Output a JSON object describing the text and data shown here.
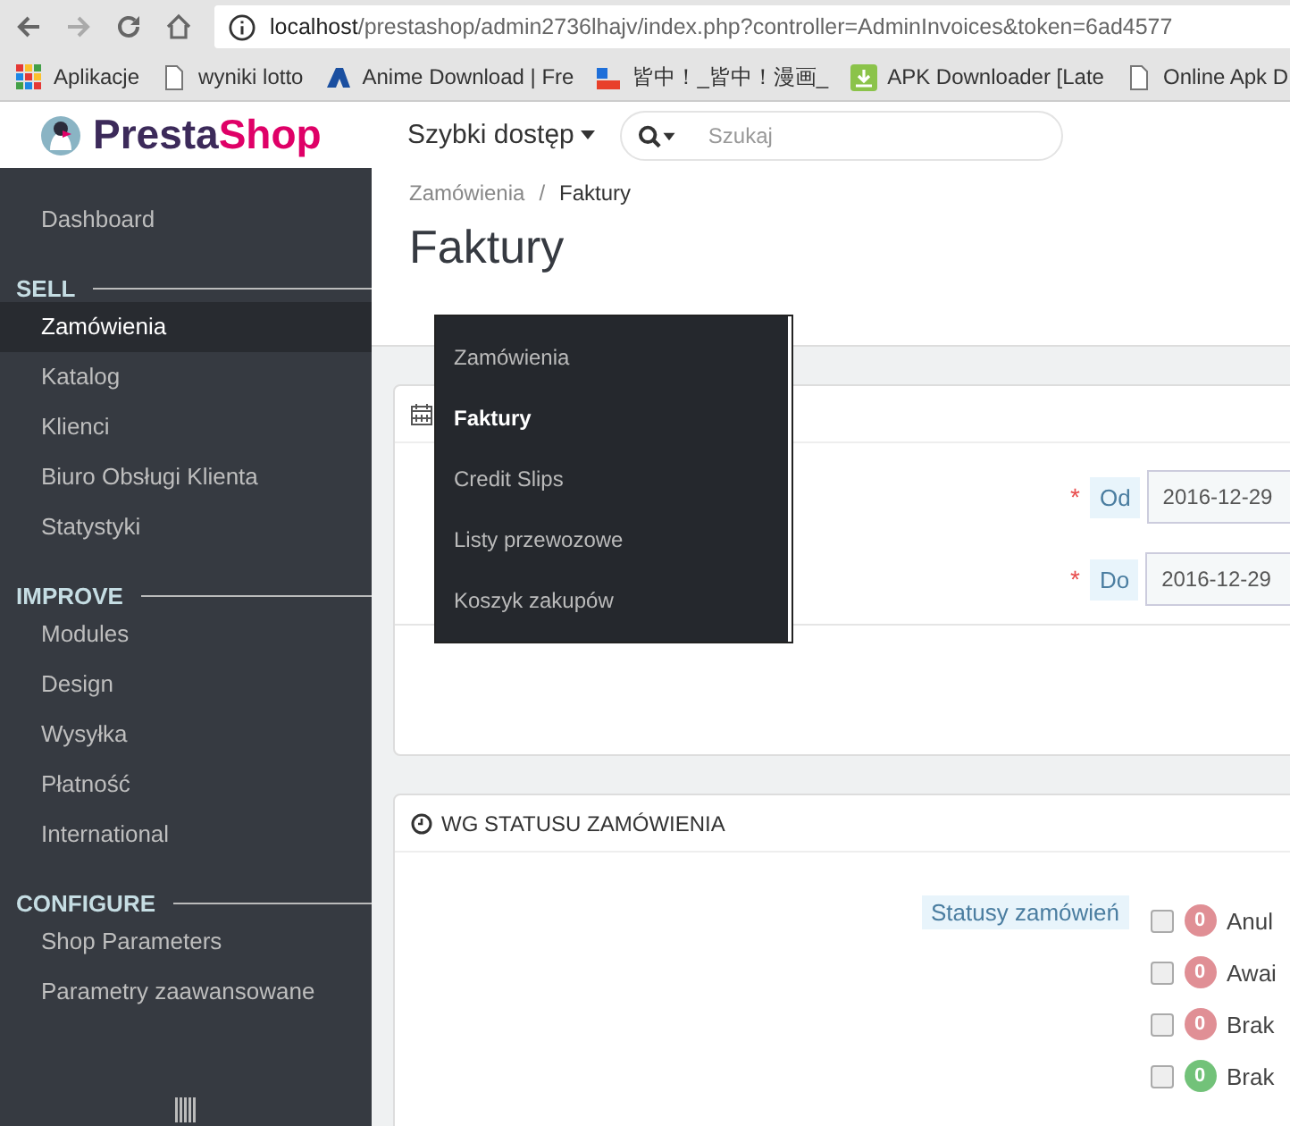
{
  "browser": {
    "url_host": "localhost",
    "url_path": "/prestashop/admin2736lhajv/index.php?controller=AdminInvoices&token=6ad4577",
    "bookmarks": [
      {
        "kind": "apps",
        "label": "Aplikacje"
      },
      {
        "kind": "page",
        "label": "wyniki lotto"
      },
      {
        "kind": "anime",
        "label": "Anime Download | Fre"
      },
      {
        "kind": "manga",
        "label": "皆中！_皆中！漫画_"
      },
      {
        "kind": "android",
        "label": "APK Downloader [Late"
      },
      {
        "kind": "page",
        "label": "Online Apk D"
      }
    ]
  },
  "header": {
    "logo_part_1": "Presta",
    "logo_part_2": "Shop",
    "quick_access": "Szybki dostęp",
    "search": {
      "placeholder": "Szukaj"
    }
  },
  "sidebar": {
    "items": [
      {
        "kind": "item",
        "label": "Dashboard",
        "selected": false
      },
      {
        "kind": "heading",
        "label": "SELL"
      },
      {
        "kind": "item",
        "label": "Zamówienia",
        "selected": true
      },
      {
        "kind": "item",
        "label": "Katalog",
        "selected": false
      },
      {
        "kind": "item",
        "label": "Klienci",
        "selected": false
      },
      {
        "kind": "item",
        "label": "Biuro Obsługi Klienta",
        "selected": false
      },
      {
        "kind": "item",
        "label": "Statystyki",
        "selected": false
      },
      {
        "kind": "heading",
        "label": "IMPROVE"
      },
      {
        "kind": "item",
        "label": "Modules",
        "selected": false
      },
      {
        "kind": "item",
        "label": "Design",
        "selected": false
      },
      {
        "kind": "item",
        "label": "Wysyłka",
        "selected": false
      },
      {
        "kind": "item",
        "label": "Płatność",
        "selected": false
      },
      {
        "kind": "item",
        "label": "International",
        "selected": false
      },
      {
        "kind": "heading",
        "label": "CONFIGURE"
      },
      {
        "kind": "item",
        "label": "Shop Parameters",
        "selected": false
      },
      {
        "kind": "item",
        "label": "Parametry zaawansowane",
        "selected": false
      }
    ]
  },
  "breadcrumb": {
    "items": [
      "Zamówienia",
      "Faktury"
    ],
    "separator": "/"
  },
  "page_title": "Faktury",
  "submenu": [
    {
      "label": "Zamówienia",
      "selected": false
    },
    {
      "label": "Faktury",
      "selected": true
    },
    {
      "label": "Credit Slips",
      "selected": false
    },
    {
      "label": "Listy przewozowe",
      "selected": false
    },
    {
      "label": "Koszyk zakupów",
      "selected": false
    }
  ],
  "date_panel": {
    "fields": [
      {
        "mark": "*",
        "label": "Od",
        "value": "2016-12-29"
      },
      {
        "mark": "*",
        "label": "Do",
        "value": "2016-12-29"
      }
    ]
  },
  "status_panel": {
    "title": "WG STATUSU ZAMÓWIENIA",
    "label": "Statusy zamówień",
    "statuses": [
      {
        "checked": false,
        "count": "0",
        "color": "#e08f95",
        "label": "Anul"
      },
      {
        "checked": false,
        "count": "0",
        "color": "#e08f95",
        "label": "Awai"
      },
      {
        "checked": false,
        "count": "0",
        "color": "#e08f95",
        "label": "Brak"
      },
      {
        "checked": false,
        "count": "0",
        "color": "#72c279",
        "label": "Brak"
      }
    ]
  }
}
